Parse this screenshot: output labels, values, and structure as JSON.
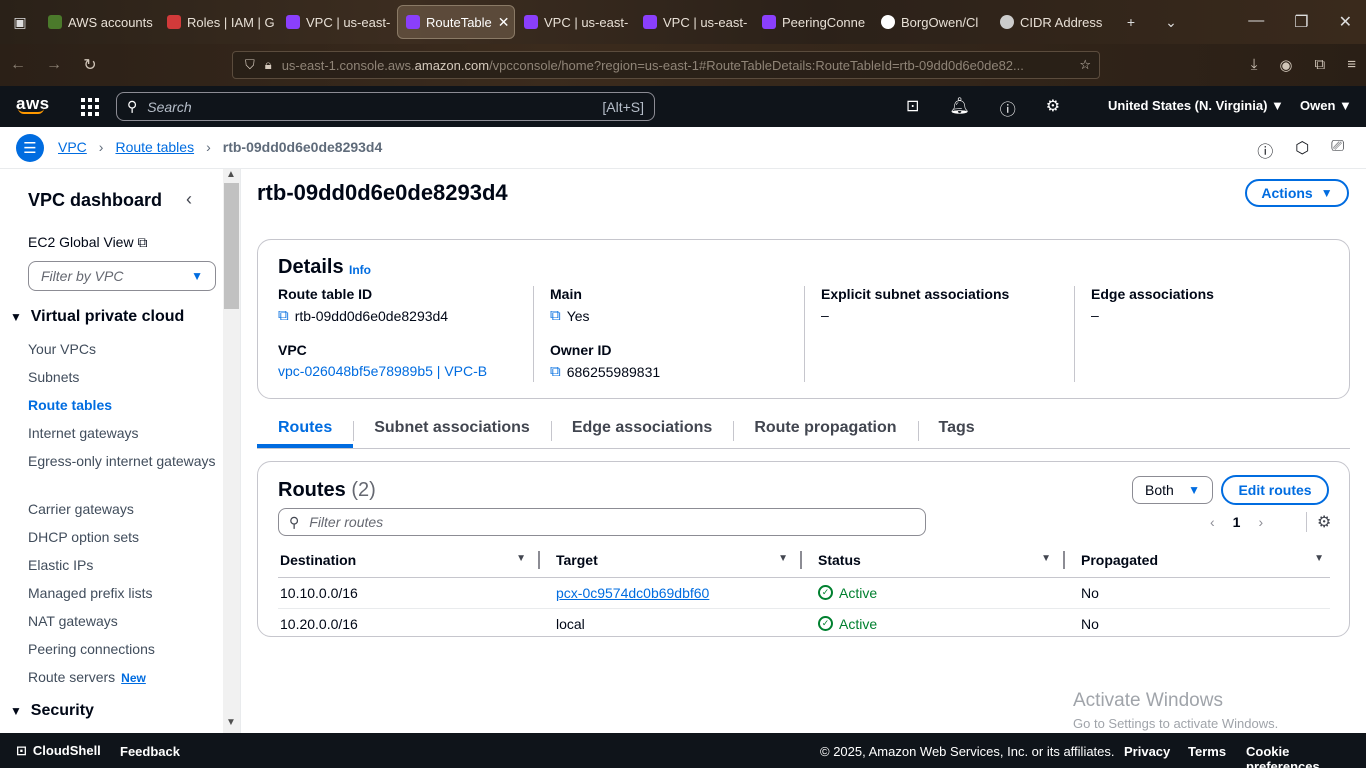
{
  "browser": {
    "tabs": [
      {
        "label": "AWS accounts",
        "color": "#4b7a2b"
      },
      {
        "label": "Roles | IAM | G",
        "color": "#d13a3a"
      },
      {
        "label": "VPC | us-east-",
        "color": "#8a3ffc"
      },
      {
        "label": "RouteTable",
        "color": "#8a3ffc",
        "active": true
      },
      {
        "label": "VPC | us-east-",
        "color": "#8a3ffc"
      },
      {
        "label": "VPC | us-east-",
        "color": "#8a3ffc"
      },
      {
        "label": "PeeringConne",
        "color": "#8a3ffc"
      },
      {
        "label": "BorgOwen/Cl",
        "color": "#ffffff"
      },
      {
        "label": "CIDR Address",
        "color": "#cccccc"
      }
    ],
    "url_prefix": "us-east-1.console.aws.",
    "url_host": "amazon.com",
    "url_path": "/vpcconsole/home?region=us-east-1#RouteTableDetails:RouteTableId=rtb-09dd0d6e0de82..."
  },
  "awsnav": {
    "logo": "aws",
    "search_placeholder": "Search",
    "search_hint": "[Alt+S]",
    "region": "United States (N. Virginia) ▼",
    "user": "Owen ▼"
  },
  "breadcrumb": {
    "items": [
      "VPC",
      "Route tables"
    ],
    "current": "rtb-09dd0d6e0de8293d4"
  },
  "sidebar": {
    "title": "VPC dashboard",
    "ec2_link": "EC2 Global View",
    "filter_placeholder": "Filter by VPC",
    "section_vpc": "Virtual private cloud",
    "items": [
      "Your VPCs",
      "Subnets",
      "Route tables",
      "Internet gateways",
      "Egress-only internet gateways",
      "Carrier gateways",
      "DHCP option sets",
      "Elastic IPs",
      "Managed prefix lists",
      "NAT gateways",
      "Peering connections",
      "Route servers"
    ],
    "new_badge": "New",
    "section_security": "Security"
  },
  "main": {
    "title": "rtb-09dd0d6e0de8293d4",
    "actions_label": "Actions",
    "details": {
      "heading": "Details",
      "info": "Info",
      "route_table_id_label": "Route table ID",
      "route_table_id": "rtb-09dd0d6e0de8293d4",
      "vpc_label": "VPC",
      "vpc_value": "vpc-026048bf5e78989b5 | VPC-B",
      "main_label": "Main",
      "main_value": "Yes",
      "owner_label": "Owner ID",
      "owner_value": "686255989831",
      "explicit_label": "Explicit subnet associations",
      "explicit_value": "–",
      "edge_label": "Edge associations",
      "edge_value": "–"
    },
    "tabs": [
      "Routes",
      "Subnet associations",
      "Edge associations",
      "Route propagation",
      "Tags"
    ],
    "routes": {
      "heading": "Routes",
      "count": "(2)",
      "both_label": "Both",
      "edit_label": "Edit routes",
      "filter_placeholder": "Filter routes",
      "page": "1",
      "columns": [
        "Destination",
        "Target",
        "Status",
        "Propagated"
      ],
      "rows": [
        {
          "destination": "10.10.0.0/16",
          "target": "pcx-0c9574dc0b69dbf60",
          "status": "Active",
          "propagated": "No"
        },
        {
          "destination": "10.20.0.0/16",
          "target": "local",
          "status": "Active",
          "propagated": "No"
        }
      ]
    }
  },
  "watermark": {
    "line1": "Activate Windows",
    "line2": "Go to Settings to activate Windows."
  },
  "footer": {
    "cloudshell": "CloudShell",
    "feedback": "Feedback",
    "copyright": "© 2025, Amazon Web Services, Inc. or its affiliates.",
    "privacy": "Privacy",
    "terms": "Terms",
    "cookies": "Cookie preferences"
  }
}
